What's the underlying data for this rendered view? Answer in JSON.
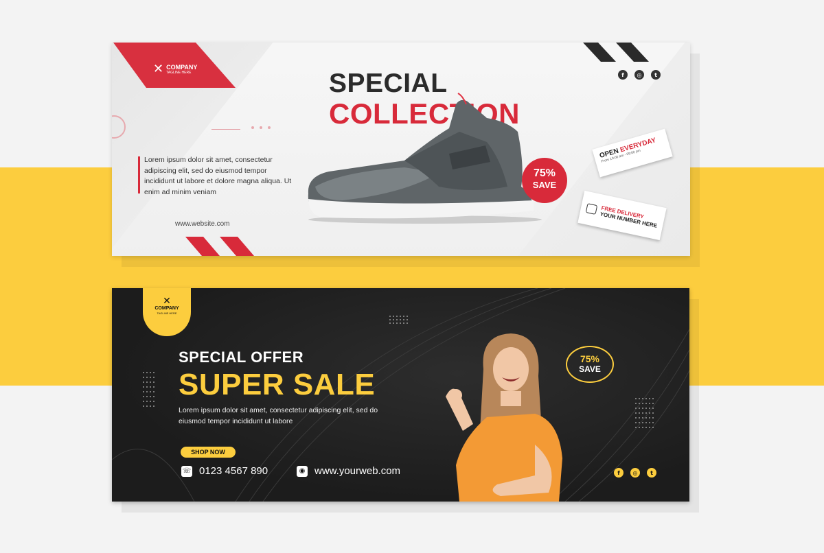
{
  "colors": {
    "red_accent": "#d82a3a",
    "yellow_accent": "#fccd3e",
    "dark_bg": "#1c1c1c",
    "light_bg": "#ececec"
  },
  "banner_light": {
    "logo": {
      "icon": "x-icon",
      "name": "COMPANY",
      "tagline": "TAGLINE HERE"
    },
    "social_icons": [
      {
        "icon": "facebook-icon",
        "glyph": "f"
      },
      {
        "icon": "instagram-icon",
        "glyph": "◎"
      },
      {
        "icon": "twitter-icon",
        "glyph": "t"
      }
    ],
    "title_line1": "SPECIAL",
    "title_line2": "COLLECTION",
    "body": "Lorem ipsum dolor sit amet, consectetur adipiscing elit, sed do eiusmod tempor incididunt ut labore et dolore magna aliqua. Ut enim ad minim veniam",
    "website": "www.website.com",
    "badge": {
      "percent": "75%",
      "label": "SAVE"
    },
    "open_card": {
      "open": "OPEN",
      "everyday": "EVERYDAY",
      "hours": "From 10:00 am - 09:00 pm"
    },
    "delivery_card": {
      "line1": "FREE DELIVERY",
      "line2": "YOUR NUMBER HERE"
    }
  },
  "banner_dark": {
    "logo": {
      "icon": "x-icon",
      "name": "COMPANY",
      "tagline": "TAGLINE HERE"
    },
    "subtitle": "SPECIAL OFFER",
    "title": "SUPER SALE",
    "body": "Lorem ipsum dolor sit amet, consectetur adipiscing elit, sed do eiusmod tempor incididunt ut labore",
    "shop_button": "SHOP NOW",
    "phone": "0123 4567 890",
    "website": "www.yourweb.com",
    "badge": {
      "percent": "75%",
      "label": "SAVE"
    },
    "social_icons": [
      {
        "icon": "facebook-icon",
        "glyph": "f"
      },
      {
        "icon": "instagram-icon",
        "glyph": "◎"
      },
      {
        "icon": "twitter-icon",
        "glyph": "t"
      }
    ]
  }
}
